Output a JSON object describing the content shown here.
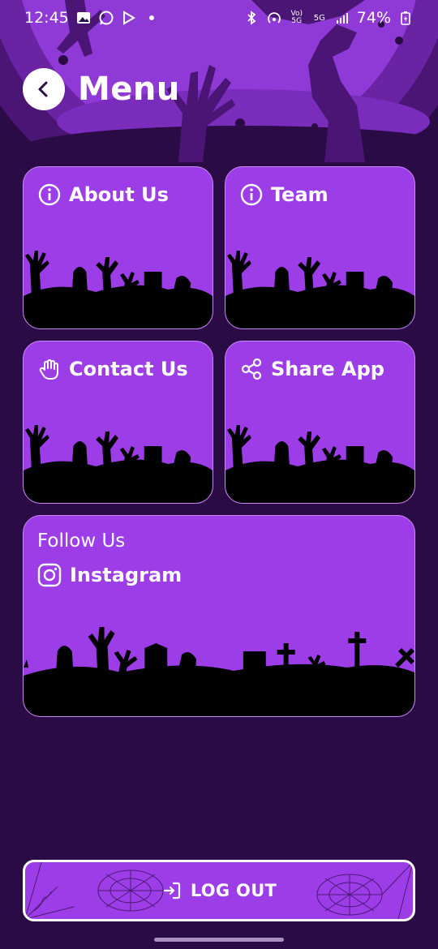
{
  "status_bar": {
    "time": "12:45",
    "battery": "74%",
    "network": "5G"
  },
  "header": {
    "title": "Menu"
  },
  "cards": {
    "about": "About Us",
    "team": "Team",
    "contact": "Contact Us",
    "share": "Share App"
  },
  "follow": {
    "heading": "Follow Us",
    "instagram": "Instagram"
  },
  "logout": {
    "label": "LOG OUT"
  },
  "icons": {
    "back": "chevron-left-icon",
    "about": "info-icon",
    "team": "info-icon",
    "contact": "hand-icon",
    "share": "share-icon",
    "instagram": "instagram-icon",
    "logout": "logout-icon"
  },
  "colors": {
    "background": "#2b0b45",
    "card": "#9c3de8",
    "moon": "#8f3ad6"
  }
}
